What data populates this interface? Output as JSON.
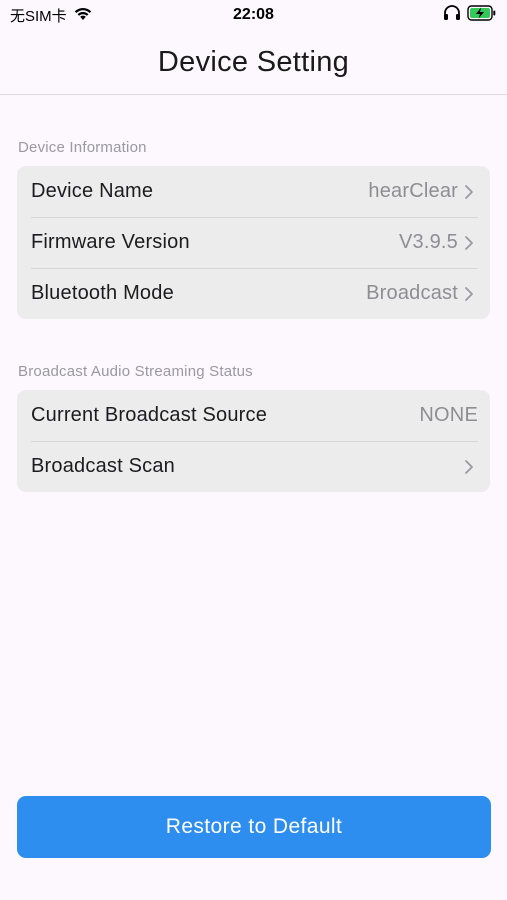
{
  "status_bar": {
    "carrier": "无SIM卡",
    "time": "22:08"
  },
  "nav": {
    "title": "Device Setting"
  },
  "device_info": {
    "header": "Device Information",
    "rows": [
      {
        "label": "Device Name",
        "value": "hearClear"
      },
      {
        "label": "Firmware Version",
        "value": "V3.9.5"
      },
      {
        "label": "Bluetooth Mode",
        "value": "Broadcast"
      }
    ]
  },
  "broadcast_status": {
    "header": "Broadcast Audio Streaming Status",
    "rows": [
      {
        "label": "Current Broadcast Source",
        "value": "NONE"
      },
      {
        "label": "Broadcast Scan",
        "value": ""
      }
    ]
  },
  "restore_button": {
    "label": "Restore to Default"
  },
  "colors": {
    "accent": "#2d8ef0",
    "background": "#fcf8fd",
    "card": "#ececed",
    "secondary_text": "#8e8d92",
    "battery_charging": "#34c759"
  }
}
